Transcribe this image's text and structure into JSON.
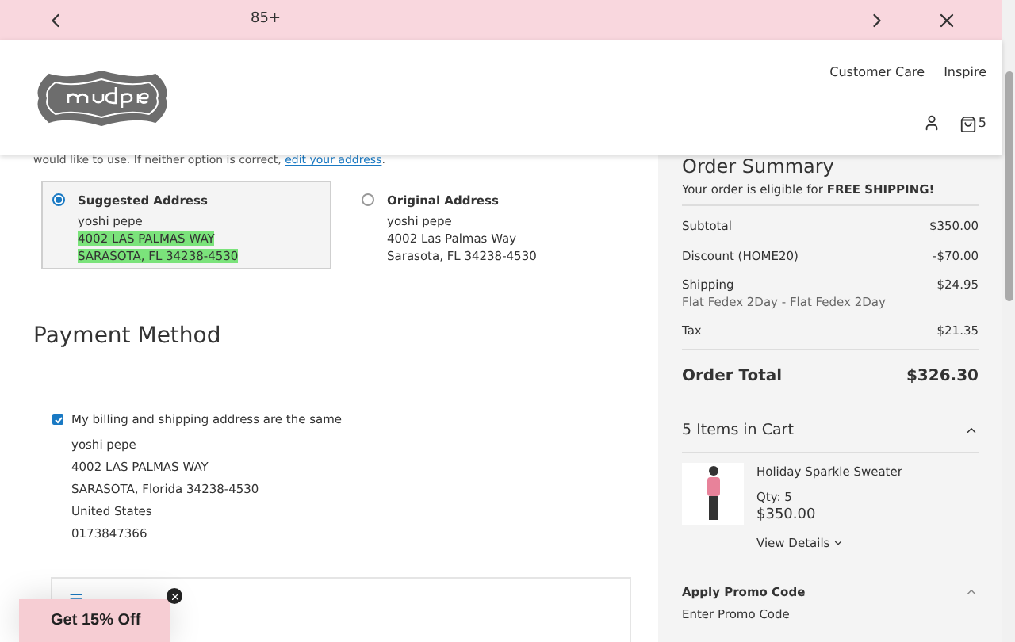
{
  "promo_banner": {
    "text": "85+"
  },
  "header": {
    "links": [
      "Customer Care",
      "Inspire"
    ],
    "cart_count": "5"
  },
  "shipping_address": {
    "instruction": "would like to use. If neither option is correct,",
    "edit_link": "edit your address",
    "instruction_end": ".",
    "options": [
      {
        "title": "Suggested Address",
        "selected": true,
        "lines": [
          "yoshi pepe",
          "4002 LAS PALMAS WAY",
          "SARASOTA, FL 34238-4530"
        ]
      },
      {
        "title": "Original Address",
        "selected": false,
        "lines": [
          "yoshi pepe",
          "4002 Las Palmas Way",
          "Sarasota, FL 34238-4530"
        ]
      }
    ]
  },
  "payment": {
    "title": "Payment Method",
    "same_address": {
      "label": "My billing and shipping address are the same",
      "checked": true
    },
    "billing_lines": [
      "yoshi pepe",
      "4002 LAS PALMAS WAY",
      "SARASOTA, Florida 34238-4530",
      "United States",
      "0173847366"
    ]
  },
  "order_summary": {
    "title": "Order Summary",
    "shipping_note": "Your order is eligible for **FREE SHIPPING!**",
    "rows": [
      {
        "label": "Subtotal",
        "value": "$350.00"
      },
      {
        "label": "Discount (HOME20)",
        "value": "-$70.00"
      },
      {
        "label": "Shipping",
        "note": "Flat Fedex 2Day - Flat Fedex 2Day",
        "value": "$24.95"
      },
      {
        "label": "Tax",
        "value": "$21.35"
      }
    ],
    "total": {
      "label": "Order Total",
      "value": "$326.30"
    },
    "cart": {
      "title": "5 Items in Cart",
      "expanded": true,
      "items": [
        {
          "name": "Holiday Sparkle Sweater",
          "qty": "Qty: 5",
          "price": "$350.00",
          "details": "View Details"
        }
      ]
    },
    "promo": {
      "title": "Apply Promo Code",
      "expanded": true,
      "placeholder": "Enter Promo Code"
    }
  },
  "popup": {
    "text": "Get 15% Off"
  }
}
